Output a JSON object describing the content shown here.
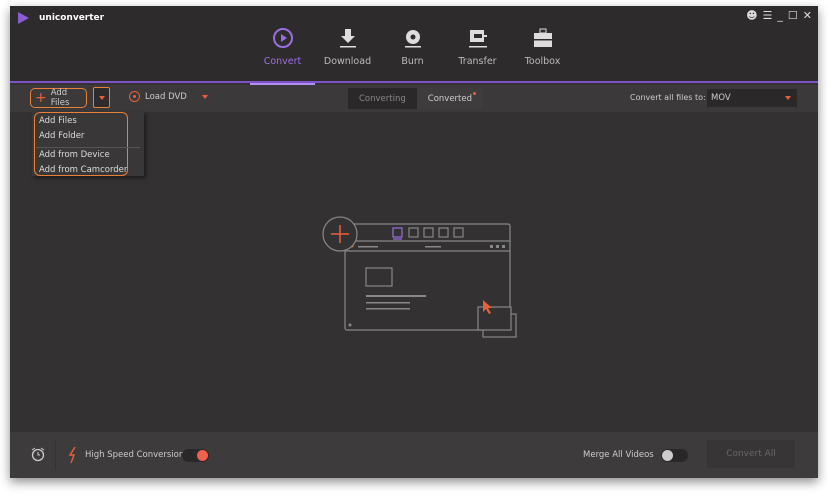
{
  "app": {
    "title": "uniconverter"
  },
  "nav": [
    {
      "label": "Convert",
      "active": true
    },
    {
      "label": "Download"
    },
    {
      "label": "Burn"
    },
    {
      "label": "Transfer"
    },
    {
      "label": "Toolbox"
    }
  ],
  "toolbar": {
    "add_files": "Add Files",
    "load_dvd": "Load DVD",
    "converting": "Converting",
    "converted": "Converted",
    "convert_all_to": "Convert all files to:",
    "format": "MOV"
  },
  "menu": [
    "Add Files",
    "Add Folder",
    "Add from Device",
    "Add from Camcorder"
  ],
  "footer": {
    "high_speed": "High Speed Conversion",
    "high_speed_on": true,
    "merge": "Merge All Videos",
    "merge_on": false,
    "convert_all": "Convert All"
  },
  "colors": {
    "accent": "#7e52c8",
    "orange": "#e8603a"
  }
}
